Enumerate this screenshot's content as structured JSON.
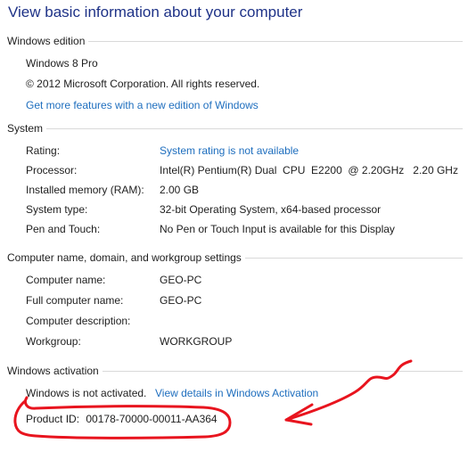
{
  "page_title": "View basic information about your computer",
  "windows_edition": {
    "heading": "Windows edition",
    "edition": "Windows 8 Pro",
    "copyright": "© 2012 Microsoft Corporation. All rights reserved.",
    "more_features_link": "Get more features with a new edition of Windows"
  },
  "system": {
    "heading": "System",
    "rows": [
      {
        "label": "Rating:",
        "value": "System rating is not available"
      },
      {
        "label": "Processor:",
        "value": "Intel(R) Pentium(R) Dual  CPU  E2200  @ 2.20GHz   2.20 GHz"
      },
      {
        "label": "Installed memory (RAM):",
        "value": "2.00 GB"
      },
      {
        "label": "System type:",
        "value": "32-bit Operating System, x64-based processor"
      },
      {
        "label": "Pen and Touch:",
        "value": "No Pen or Touch Input is available for this Display"
      }
    ]
  },
  "computer_name": {
    "heading": "Computer name, domain, and workgroup settings",
    "rows": [
      {
        "label": "Computer name:",
        "value": "GEO-PC"
      },
      {
        "label": "Full computer name:",
        "value": "GEO-PC"
      },
      {
        "label": "Computer description:",
        "value": ""
      },
      {
        "label": "Workgroup:",
        "value": "WORKGROUP"
      }
    ]
  },
  "activation": {
    "heading": "Windows activation",
    "status": "Windows is not activated.",
    "details_link": "View details in Windows Activation",
    "product_id_label": "Product ID:",
    "product_id": "00178-70000-00011-AA364"
  },
  "annotation_color": "#e8141e"
}
